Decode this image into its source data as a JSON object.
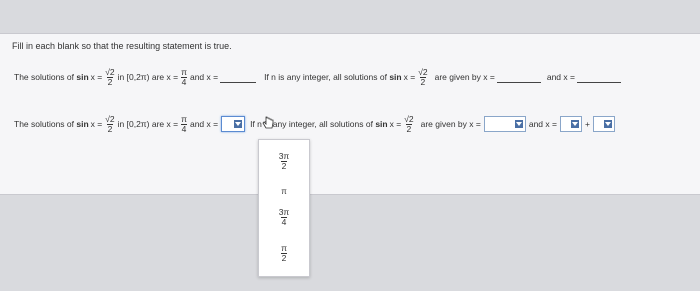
{
  "instructions": "Fill in each blank so that the resulting statement is true.",
  "row1": {
    "t1": "The solutions of",
    "fn": "sin",
    "xeq": "x =",
    "num": "√2",
    "den": "2",
    "t2": "in [0,2π) are x =",
    "pi_num": "π",
    "pi_den": "4",
    "t3": "and x =",
    "t4": "If n is any integer, all solutions of",
    "t5": "are given by x =",
    "t6": "and x ="
  },
  "row2": {
    "t1": "The solutions of",
    "fn": "sin",
    "xeq": "x =",
    "num": "√2",
    "den": "2",
    "t2": "in [0,2π) are x =",
    "pi_num": "π",
    "pi_den": "4",
    "t3": "and x =",
    "t4": "If n is any integer, all solutions of",
    "t5": "are given by x =",
    "t6": "and x =",
    "plus": "+"
  },
  "dropdown_options": [
    {
      "num": "3π",
      "den": "2"
    },
    {
      "single": "π"
    },
    {
      "num": "3π",
      "den": "4"
    },
    {
      "num": "π",
      "den": "2"
    }
  ],
  "icons": {
    "dropdown_arrow": "triangle-down",
    "cursor": "hand-pointer"
  },
  "colors": {
    "dropdown_border": "#8aa6c9",
    "arrow": "#4a6fa5"
  }
}
